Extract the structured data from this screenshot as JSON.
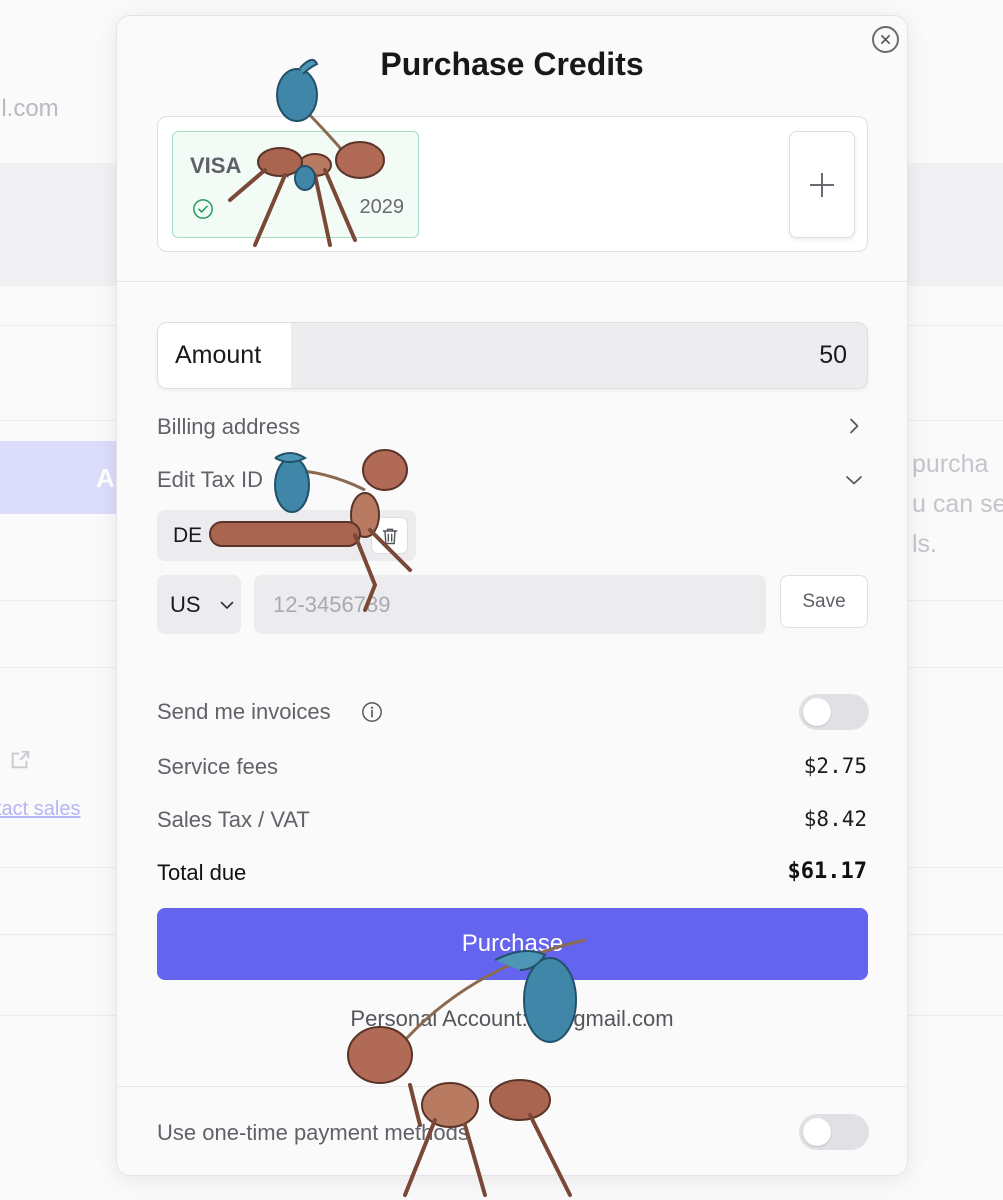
{
  "background": {
    "email_fragment": "il.com",
    "button_fragment": "A",
    "right_text_lines": [
      "purcha",
      "u can se",
      "ls."
    ],
    "contact_link": "tact sales"
  },
  "modal": {
    "title": "Purchase Credits",
    "close_icon": "close-icon",
    "payment_card": {
      "brand": "VISA",
      "masked": "• (",
      "expiry": "2029",
      "status_icon": "check-circle-icon"
    },
    "add_card_icon": "plus-icon",
    "amount": {
      "label": "Amount",
      "value": "50"
    },
    "billing_address": {
      "label": "Billing address",
      "icon": "chevron-right-icon"
    },
    "edit_tax_id": {
      "label": "Edit Tax ID",
      "icon": "chevron-down-icon",
      "saved_prefix": "DE",
      "delete_icon": "trash-icon",
      "country": "US",
      "placeholder": "12-3456789",
      "save_label": "Save"
    },
    "send_invoices": {
      "label": "Send me invoices",
      "icon": "info-icon",
      "enabled": false
    },
    "service_fees": {
      "label": "Service fees",
      "value": "$2.75"
    },
    "sales_tax": {
      "label": "Sales Tax / VAT",
      "value": "$8.42"
    },
    "total": {
      "label": "Total due",
      "value": "$61.17"
    },
    "purchase_label": "Purchase",
    "account_line": "Personal Account: ja@gmail.com",
    "one_time": {
      "label": "Use one-time payment methods",
      "enabled": false
    }
  },
  "colors": {
    "accent": "#6464ee",
    "card_border": "#a8dcc2",
    "card_check": "#1f9a5b"
  }
}
